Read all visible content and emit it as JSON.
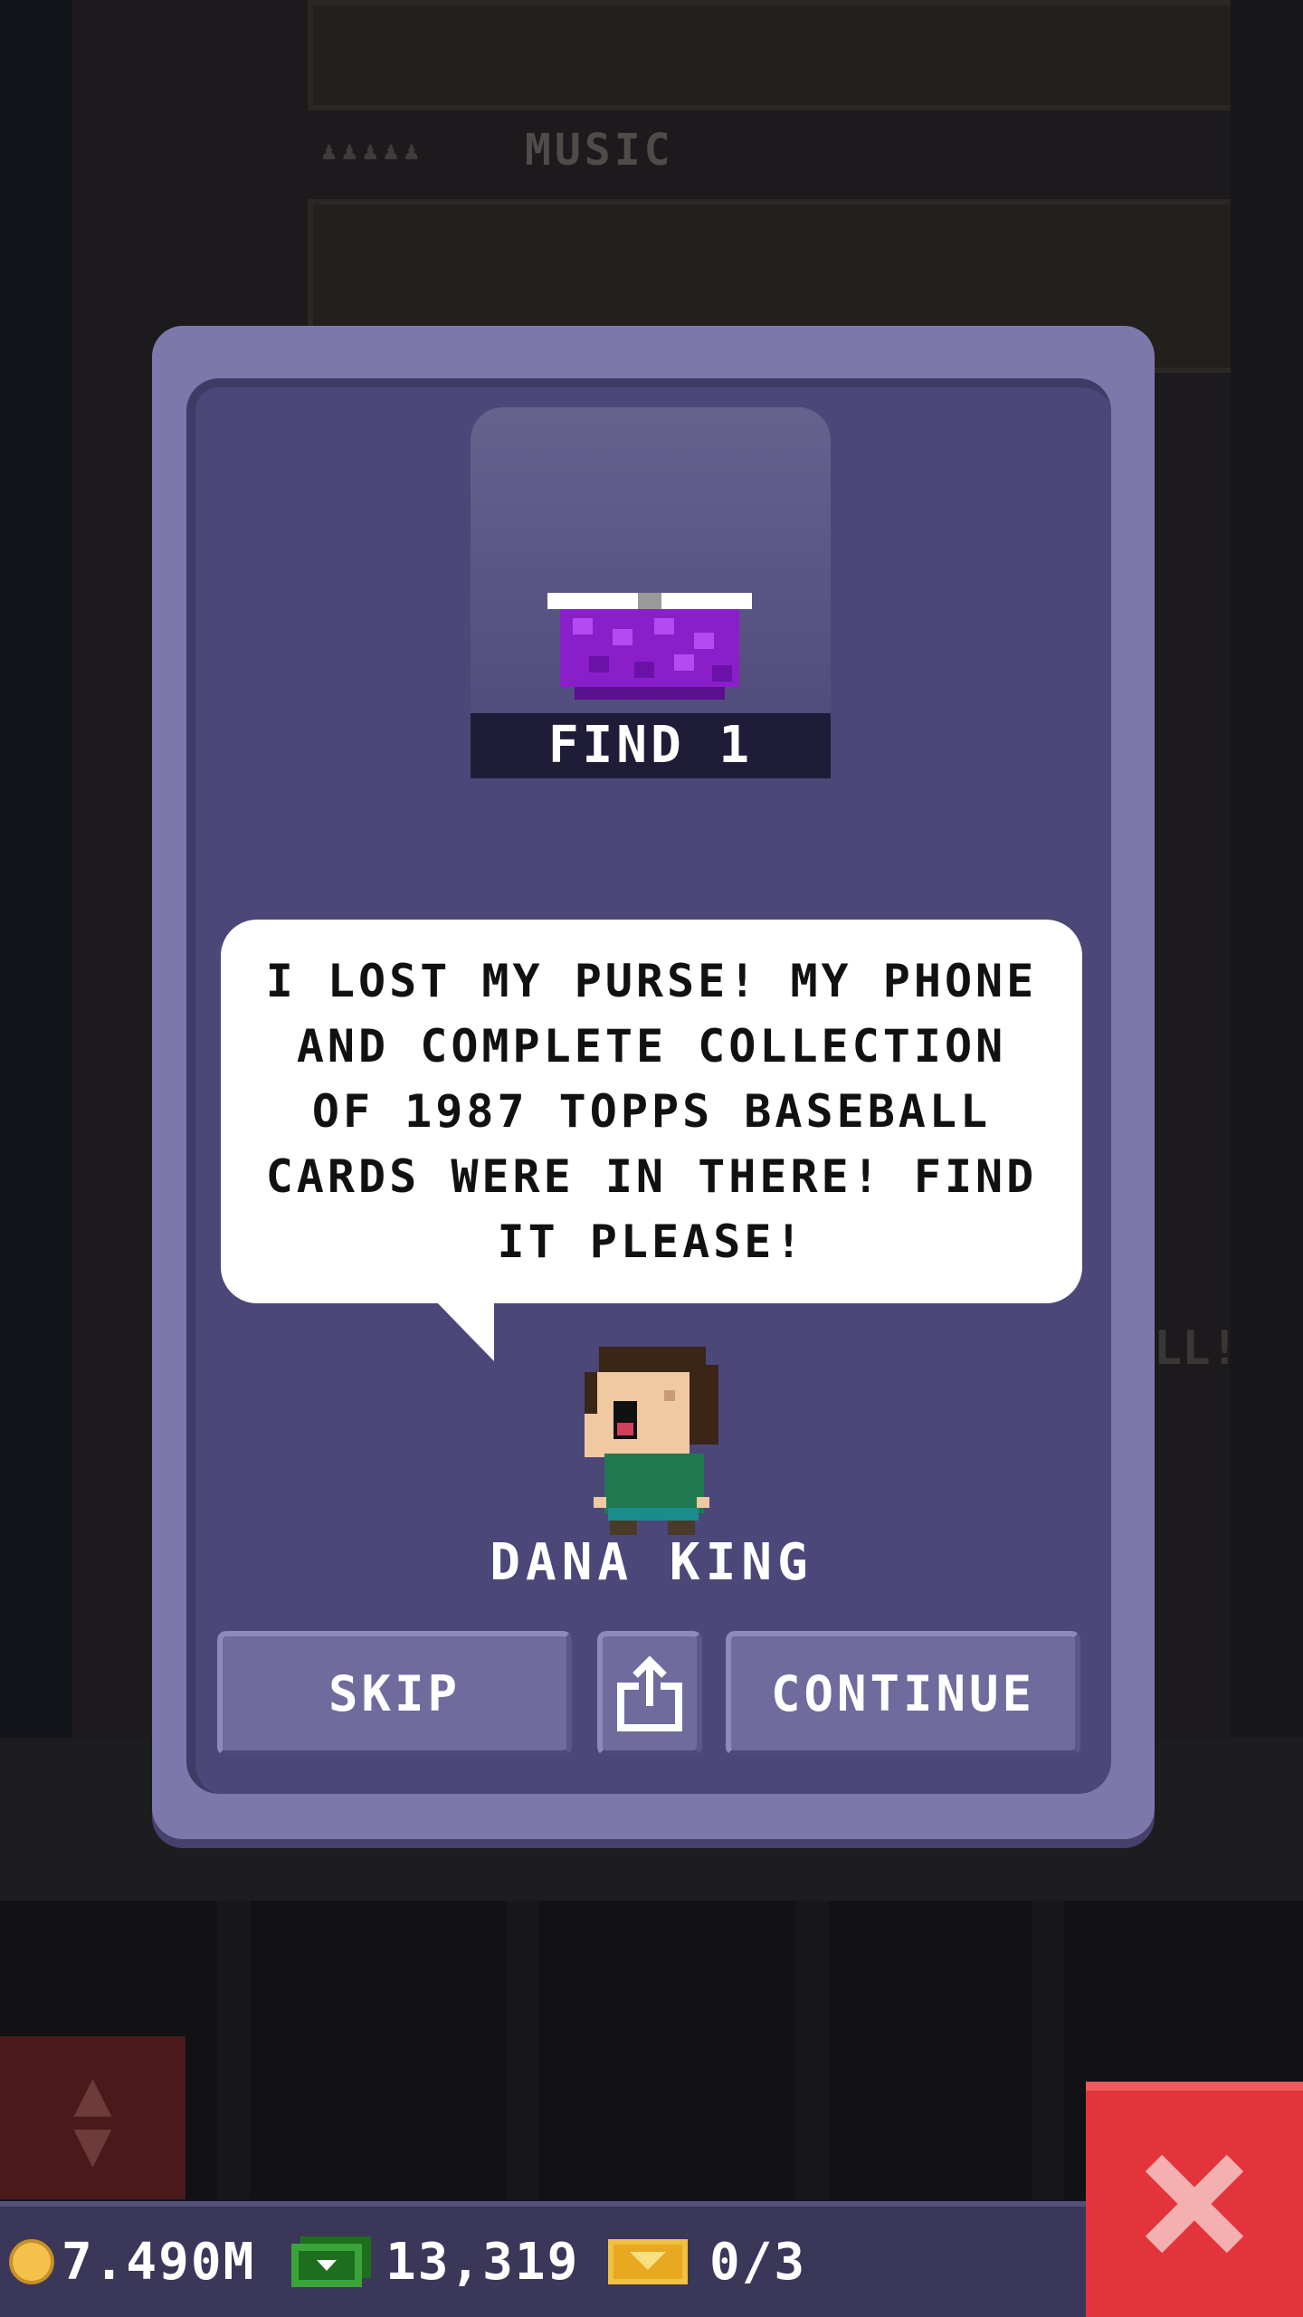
{
  "background": {
    "floor_label": "MUSIC",
    "partial_sign_text": "LL!"
  },
  "quest": {
    "item_name": "purse-icon",
    "objective": "FIND 1",
    "speech": "I LOST MY PURSE! MY PHONE AND COMPLETE COLLECTION OF 1987 TOPPS BASEBALL CARDS WERE IN THERE! FIND IT PLEASE!",
    "npc_name": "DANA KING"
  },
  "buttons": {
    "skip": "SKIP",
    "share_icon": "share-icon",
    "continue": "CONTINUE"
  },
  "hud": {
    "coins": "7.490M",
    "bux": "13,319",
    "tickets": "0/3",
    "close_icon": "close-icon"
  },
  "colors": {
    "dialog_frame": "#7d78ab",
    "dialog_body": "#4b4778",
    "button": "#6f6b9c",
    "close_button": "#e2343a",
    "coin": "#f4c24a",
    "bux": "#3aa43a",
    "ticket": "#f0c040",
    "purse": "#9a22d6"
  }
}
